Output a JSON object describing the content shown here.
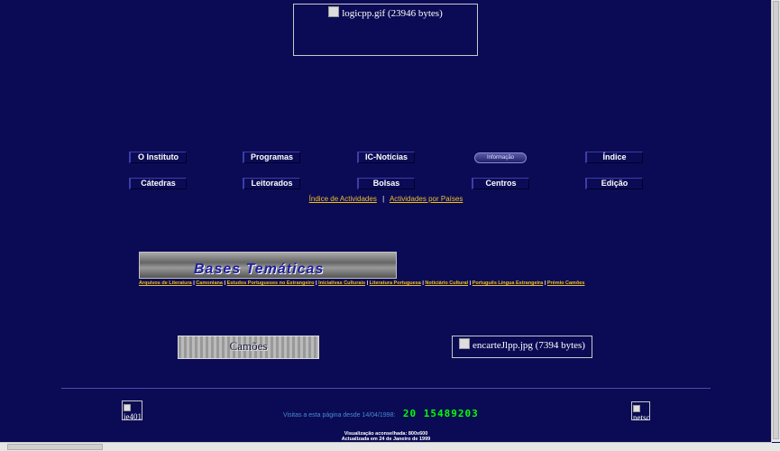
{
  "header": {
    "logo_alt": "logicpp.gif (23946 bytes)"
  },
  "nav": {
    "row1": [
      "O Instituto",
      "Programas",
      "IC-Notícias",
      "Informação",
      "Índice"
    ],
    "row2": [
      "Cátedras",
      "Leitorados",
      "Bolsas",
      "Centros",
      "Edição"
    ]
  },
  "activity_links": {
    "index": "Índice de Actividades",
    "separator": "|",
    "by_country": "Actividades por Países"
  },
  "bases": {
    "banner_title": "Bases Temáticas",
    "links": [
      "Arquivos de Literatura",
      "Camoniana",
      "Estudos Portugueses no Estrangeiro",
      "Iniciativas Culturais",
      "Literatura Portuguesa",
      "Noticiário Cultural",
      "Português Língua Estrangeira",
      "Prémio Camões"
    ],
    "sep": "|"
  },
  "camoes_banner": "Camões",
  "encarte_alt": "encarteJlpp.jpg (7394 bytes)",
  "footer": {
    "ie_alt": "ie401",
    "netsc_alt": "netsc",
    "visits_label": "Visitas a esta página desde 14/04/1998:",
    "counter": "20 15489203",
    "resolution": "Visualização aconselhada: 800x600",
    "updated": "Actualizada em 24 de Janeiro de 1999"
  }
}
